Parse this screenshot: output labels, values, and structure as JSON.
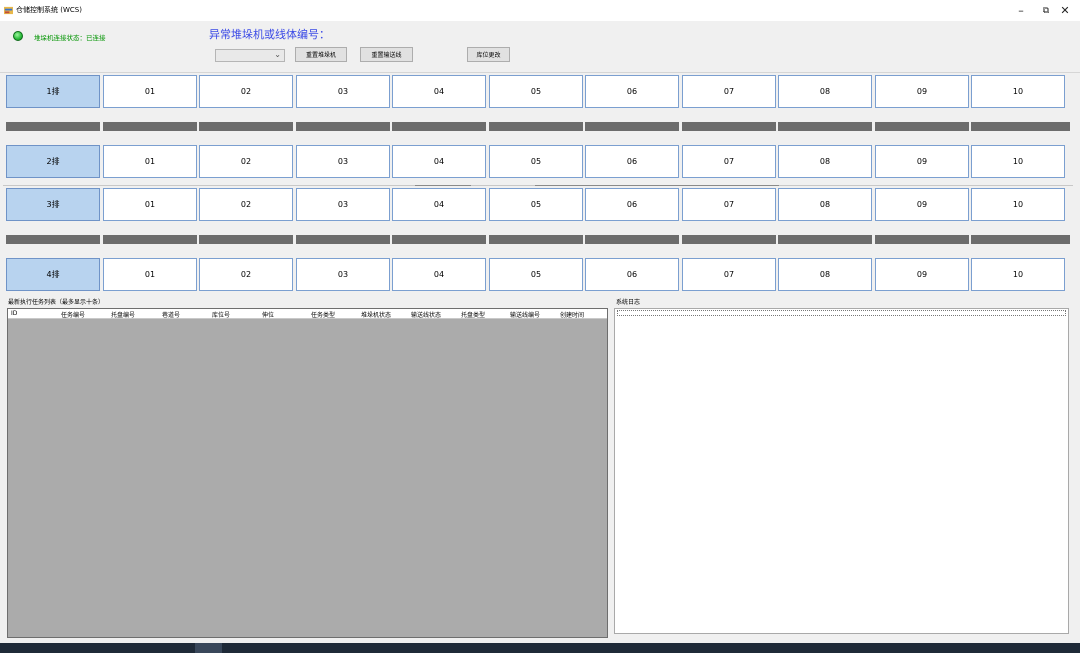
{
  "window": {
    "title": "仓储控制系统 (WCS)",
    "controls": {
      "minimize": "–",
      "maximize": "⧉",
      "close": "✕"
    }
  },
  "header": {
    "status_text": "堆垛机连接状态：已连接",
    "status_color": "#2fbf3f",
    "abnormal_title": "异常堆垛机或线体编号：",
    "select_value": "",
    "buttons": {
      "reset_stacker": "重置堆垛机",
      "reset_conveyor": "重置输送线",
      "location_change": "库位更改"
    }
  },
  "rows": [
    {
      "label": "1排",
      "cells": [
        "01",
        "02",
        "03",
        "04",
        "05",
        "06",
        "07",
        "08",
        "09",
        "10"
      ]
    },
    {
      "label": "2排",
      "cells": [
        "01",
        "02",
        "03",
        "04",
        "05",
        "06",
        "07",
        "08",
        "09",
        "10"
      ]
    },
    {
      "label": "3排",
      "cells": [
        "01",
        "02",
        "03",
        "04",
        "05",
        "06",
        "07",
        "08",
        "09",
        "10"
      ]
    },
    {
      "label": "4排",
      "cells": [
        "01",
        "02",
        "03",
        "04",
        "05",
        "06",
        "07",
        "08",
        "09",
        "10"
      ]
    }
  ],
  "task_list": {
    "title": "最新执行任务列表（最多显示十条）",
    "columns": [
      "ID",
      "任务编号",
      "托盘编号",
      "巷道号",
      "库位号",
      "伸位",
      "任务类型",
      "堆垛机状态",
      "输送线状态",
      "托盘类型",
      "输送线编号",
      "创建时间"
    ]
  },
  "log": {
    "title": "系统日志"
  },
  "colors": {
    "row_head_bg": "#b8d3ef",
    "cell_border": "#7b9fd0",
    "bar": "#6c6c6c",
    "abnormal_title": "#3a49e6"
  }
}
